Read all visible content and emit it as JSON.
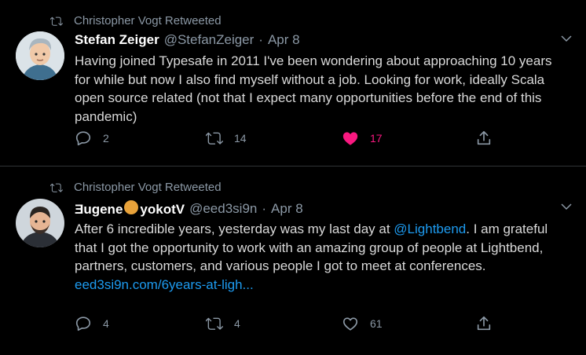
{
  "tweets": [
    {
      "retweeted_by": "Christopher Vogt Retweeted",
      "author_name": "Stefan Zeiger",
      "author_handle": "@StefanZeiger",
      "separator": "·",
      "date": "Apr 8",
      "text": "Having joined Typesafe in 2011 I've been wondering about approaching 10 years for while but now I also find myself without a job. Looking for work, ideally Scala open source related (not that I expect many opportunities before the end of this pandemic)",
      "replies": "2",
      "retweets": "14",
      "likes": "17",
      "liked": true
    },
    {
      "retweeted_by": "Christopher Vogt Retweeted",
      "author_name_part1": "Ǝugene",
      "author_name_part2": "yokotV",
      "author_handle": "@eed3si9n",
      "separator": "·",
      "date": "Apr 8",
      "text_before_mention": "After 6 incredible years, yesterday was my last day at ",
      "mention": "@Lightbend",
      "text_after_mention": ". I am grateful that I got the opportunity to work with an amazing group of people at Lightbend, partners, customers, and various people I got to meet at conferences.",
      "url": "eed3si9n.com/6years-at-ligh...",
      "replies": "4",
      "retweets": "4",
      "likes": "61",
      "liked": false
    }
  ],
  "colors": {
    "background": "#000000",
    "muted": "#8b98a5",
    "link": "#1d9bf0",
    "like_active": "#f91880"
  }
}
